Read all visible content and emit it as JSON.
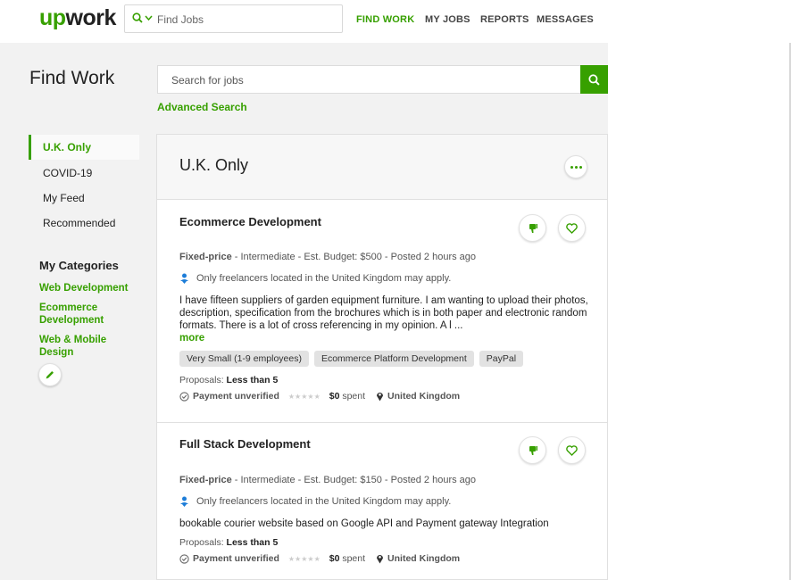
{
  "header": {
    "logo_up": "up",
    "logo_work": "work",
    "search_placeholder": "Find Jobs",
    "nav": [
      "FIND WORK",
      "MY JOBS",
      "REPORTS",
      "MESSAGES"
    ]
  },
  "page": {
    "title": "Find Work",
    "search_placeholder": "Search for jobs",
    "advanced_search": "Advanced Search"
  },
  "sidebar": {
    "feeds": [
      "U.K. Only",
      "COVID-19",
      "My Feed",
      "Recommended"
    ],
    "categories_title": "My Categories",
    "categories": [
      "Web Development",
      "Ecommerce Development",
      "Web & Mobile Design"
    ]
  },
  "feed": {
    "title": "U.K. Only",
    "jobs": [
      {
        "title": "Ecommerce Development",
        "type": "Fixed-price",
        "details": " - Intermediate - Est. Budget: $500 - Posted 2 hours ago",
        "location_note": "Only freelancers located in the United Kingdom may apply.",
        "description": "I have fifteen suppliers of garden equipment furniture. I am wanting to upload their photos, description, specification from the brochures which is in both paper and electronic random formats. There is a lot of cross referencing in my opinion. A l ...",
        "more": "more",
        "tags": [
          "Very Small (1-9 employees)",
          "Ecommerce Platform Development",
          "PayPal"
        ],
        "proposals_label": "Proposals: ",
        "proposals": "Less than 5",
        "payment": "Payment unverified",
        "spent_amount": "$0",
        "spent_label": " spent",
        "country": "United Kingdom"
      },
      {
        "title": "Full Stack Development",
        "type": "Fixed-price",
        "details": " - Intermediate - Est. Budget: $150 - Posted 2 hours ago",
        "location_note": "Only freelancers located in the United Kingdom may apply.",
        "description": "bookable courier website based on Google API and Payment gateway Integration",
        "proposals_label": "Proposals: ",
        "proposals": "Less than 5",
        "payment": "Payment unverified",
        "spent_amount": "$0",
        "spent_label": " spent",
        "country": "United Kingdom"
      }
    ]
  },
  "colors": {
    "accent": "#37a000",
    "background": "#f2f2f2"
  }
}
